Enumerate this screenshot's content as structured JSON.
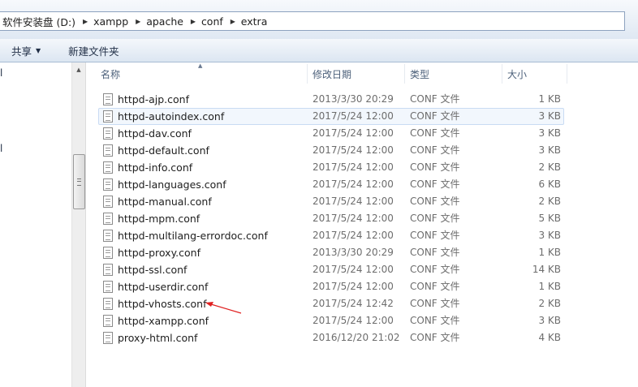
{
  "address": {
    "crumbs": [
      "软件安装盘 (D:)",
      "xampp",
      "apache",
      "conf",
      "extra"
    ]
  },
  "toolbar": {
    "share_label": "共享",
    "new_folder_label": "新建文件夹"
  },
  "nav": {
    "fragments": [
      "l",
      "l"
    ]
  },
  "columns": {
    "name": "名称",
    "date": "修改日期",
    "type": "类型",
    "size": "大小"
  },
  "files": [
    {
      "name": "httpd-ajp.conf",
      "date": "2013/3/30 20:29",
      "type": "CONF 文件",
      "size": "1 KB"
    },
    {
      "name": "httpd-autoindex.conf",
      "date": "2017/5/24 12:00",
      "type": "CONF 文件",
      "size": "3 KB"
    },
    {
      "name": "httpd-dav.conf",
      "date": "2017/5/24 12:00",
      "type": "CONF 文件",
      "size": "3 KB"
    },
    {
      "name": "httpd-default.conf",
      "date": "2017/5/24 12:00",
      "type": "CONF 文件",
      "size": "3 KB"
    },
    {
      "name": "httpd-info.conf",
      "date": "2017/5/24 12:00",
      "type": "CONF 文件",
      "size": "2 KB"
    },
    {
      "name": "httpd-languages.conf",
      "date": "2017/5/24 12:00",
      "type": "CONF 文件",
      "size": "6 KB"
    },
    {
      "name": "httpd-manual.conf",
      "date": "2017/5/24 12:00",
      "type": "CONF 文件",
      "size": "2 KB"
    },
    {
      "name": "httpd-mpm.conf",
      "date": "2017/5/24 12:00",
      "type": "CONF 文件",
      "size": "5 KB"
    },
    {
      "name": "httpd-multilang-errordoc.conf",
      "date": "2017/5/24 12:00",
      "type": "CONF 文件",
      "size": "3 KB"
    },
    {
      "name": "httpd-proxy.conf",
      "date": "2013/3/30 20:29",
      "type": "CONF 文件",
      "size": "1 KB"
    },
    {
      "name": "httpd-ssl.conf",
      "date": "2017/5/24 12:00",
      "type": "CONF 文件",
      "size": "14 KB"
    },
    {
      "name": "httpd-userdir.conf",
      "date": "2017/5/24 12:00",
      "type": "CONF 文件",
      "size": "1 KB"
    },
    {
      "name": "httpd-vhosts.conf",
      "date": "2017/5/24 12:42",
      "type": "CONF 文件",
      "size": "2 KB"
    },
    {
      "name": "httpd-xampp.conf",
      "date": "2017/5/24 12:00",
      "type": "CONF 文件",
      "size": "3 KB"
    },
    {
      "name": "proxy-html.conf",
      "date": "2016/12/20 21:02",
      "type": "CONF 文件",
      "size": "4 KB"
    }
  ],
  "hovered_index": 1,
  "annotation": {
    "color": "#e02020"
  }
}
